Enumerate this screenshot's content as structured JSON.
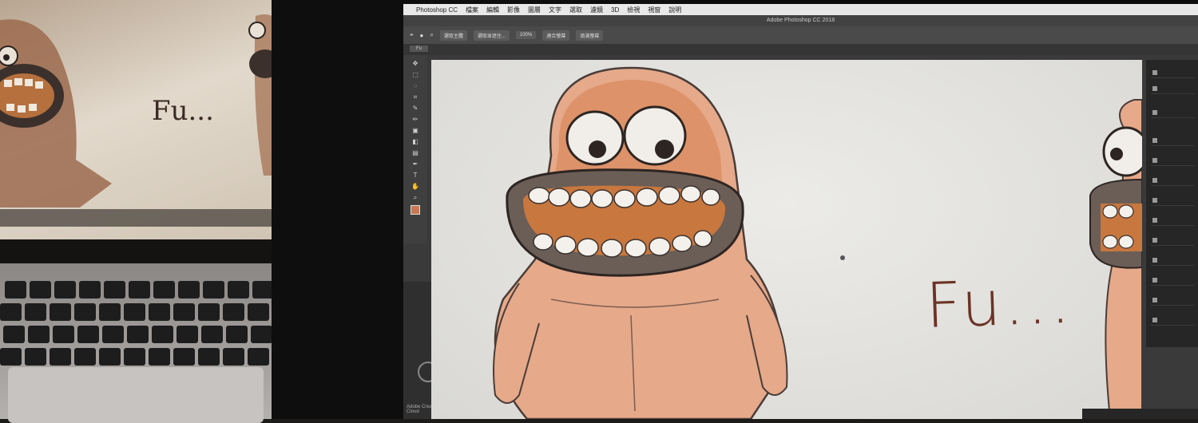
{
  "window": {
    "app_name": "Photoshop CC",
    "title": "Adobe Photoshop CC 2018"
  },
  "menubar": {
    "items": [
      "檔案",
      "編輯",
      "影像",
      "圖層",
      "文字",
      "選取",
      "濾鏡",
      "3D",
      "檢視",
      "視窗",
      "說明"
    ]
  },
  "options_bar": {
    "buttons": [
      "選取主體",
      "選取並遮住...",
      "100%",
      "適合螢幕",
      "填滿螢幕"
    ]
  },
  "document": {
    "tab_label": "Fu"
  },
  "canvas": {
    "sketch_text": "Fu..."
  },
  "laptop": {
    "sketch_text": "Fu..."
  },
  "panel": {
    "cc_text": "Adobe Creative Cloud"
  },
  "colors": {
    "foreground": "#c77a52",
    "character_fill": "#d99a72",
    "character_dark": "#b9734c",
    "mouth_ring": "#6a5e57",
    "mouth_inner": "#c8773f"
  }
}
